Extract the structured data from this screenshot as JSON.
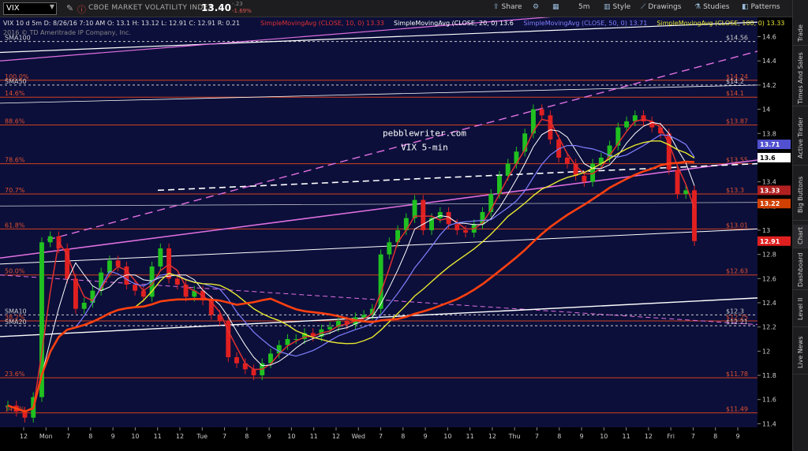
{
  "toolbar": {
    "symbol": "VIX",
    "symbol_desc": "CBOE MARKET VOLATILITY INDEX",
    "last": "13.40",
    "change_abs": "-.23",
    "change_pct": "-1.69%",
    "share_label": "Share",
    "period_label": "5m",
    "style_label": "Style",
    "drawings_label": "Drawings",
    "studies_label": "Studies",
    "patterns_label": "Patterns"
  },
  "side_tabs": [
    "Trade",
    "Times And Sales",
    "Active Trader",
    "Big Buttons",
    "Chart",
    "Dashboard",
    "Level II",
    "Live News"
  ],
  "header": {
    "ohlc": "VIX 10 d 5m  D: 8/26/16 7:10 AM  O: 13.1  H: 13.12  L: 12.91  C: 12.91  R: 0.21",
    "copyright": "2016 © TD Ameritrade IP Company, Inc.",
    "studies": [
      {
        "label": "SimpleMovingAvg (CLOSE, 10, 0)",
        "value": "13.33",
        "color": "#e03030"
      },
      {
        "label": "SimpleMovingAvg (CLOSE, 20, 0)",
        "value": "13.6",
        "color": "#ffffff"
      },
      {
        "label": "SimpleMovingAvg (CLOSE, 50, 0)",
        "value": "13.71",
        "color": "#8080ff"
      },
      {
        "label": "SimpleMovingAvg (CLOSE, 100, 0)",
        "value": "13.33",
        "color": "#e8e830"
      }
    ]
  },
  "watermark": {
    "line1": "pebblewriter.com",
    "line2": "VIX 5-min"
  },
  "chart_data": {
    "type": "candlestick",
    "ylim": [
      11.37,
      14.76
    ],
    "y_ticks": [
      11.4,
      11.6,
      11.8,
      12,
      12.2,
      12.4,
      12.6,
      12.8,
      13,
      13.2,
      13.4,
      13.6,
      13.8,
      14,
      14.2,
      14.4,
      14.6
    ],
    "x_ticks": [
      "12",
      "Mon",
      "7",
      "8",
      "9",
      "10",
      "11",
      "12",
      "Tue",
      "7",
      "8",
      "9",
      "10",
      "11",
      "12",
      "Wed",
      "7",
      "8",
      "9",
      "10",
      "11",
      "12",
      "Thu",
      "7",
      "8",
      "9",
      "10",
      "11",
      "12",
      "Fri",
      "7",
      "8",
      "9"
    ],
    "levels": [
      {
        "label": "SMA100",
        "value": 14.56,
        "price_tag": "$14.56"
      },
      {
        "label": "100.0%",
        "value": 14.24,
        "price_tag": "$14.24"
      },
      {
        "label": "SMA50",
        "value": 14.2,
        "price_tag": "$14.2"
      },
      {
        "label": "14.6%",
        "value": 14.1,
        "price_tag": "$14.1"
      },
      {
        "label": "88.6%",
        "value": 13.87,
        "price_tag": "$13.87"
      },
      {
        "label": "78.6%",
        "value": 13.55,
        "price_tag": "$13.55"
      },
      {
        "label": "70.7%",
        "value": 13.3,
        "price_tag": "$13.3"
      },
      {
        "label": "61.8%",
        "value": 13.01,
        "price_tag": "$13.01"
      },
      {
        "label": "50.0%",
        "value": 12.63,
        "price_tag": "$12.63"
      },
      {
        "label": "SMA10",
        "value": 12.3,
        "price_tag": "$12.3"
      },
      {
        "label": "38.2%",
        "value": 12.25,
        "price_tag": "$12.25"
      },
      {
        "label": "SMA20",
        "value": 12.21,
        "price_tag": "$12.21"
      },
      {
        "label": "23.6%",
        "value": 11.78,
        "price_tag": "$11.78"
      },
      {
        "label": "14.6%",
        "value": 11.49,
        "price_tag": "$11.49"
      }
    ],
    "price_tags": [
      {
        "value": 13.71,
        "text": "13.71",
        "color": "#5050d0"
      },
      {
        "value": 13.6,
        "text": "13.6",
        "color": "#ffffff"
      },
      {
        "value": 13.33,
        "text": "13.33",
        "color": "#b02020"
      },
      {
        "value": 13.22,
        "text": "13.22",
        "color": "#d04000"
      },
      {
        "value": 12.91,
        "text": "12.91",
        "color": "#e02020"
      }
    ],
    "close_series": [
      11.55,
      11.5,
      11.45,
      11.62,
      12.9,
      12.95,
      12.85,
      12.6,
      12.35,
      12.4,
      12.5,
      12.65,
      12.75,
      12.7,
      12.55,
      12.5,
      12.45,
      12.7,
      12.85,
      12.6,
      12.55,
      12.45,
      12.5,
      12.42,
      12.3,
      12.25,
      11.95,
      11.9,
      11.85,
      11.8,
      11.9,
      11.98,
      12.05,
      12.1,
      12.1,
      12.15,
      12.12,
      12.18,
      12.2,
      12.25,
      12.22,
      12.28,
      12.3,
      12.35,
      12.8,
      12.9,
      13.0,
      13.1,
      13.25,
      13.0,
      13.1,
      13.15,
      13.05,
      13.0,
      12.98,
      13.05,
      13.15,
      13.3,
      13.45,
      13.55,
      13.65,
      13.8,
      14.0,
      13.95,
      13.75,
      13.6,
      13.55,
      13.45,
      13.4,
      13.55,
      13.6,
      13.7,
      13.85,
      13.9,
      13.95,
      13.9,
      13.85,
      13.8,
      13.5,
      13.3,
      13.33,
      12.91
    ]
  }
}
